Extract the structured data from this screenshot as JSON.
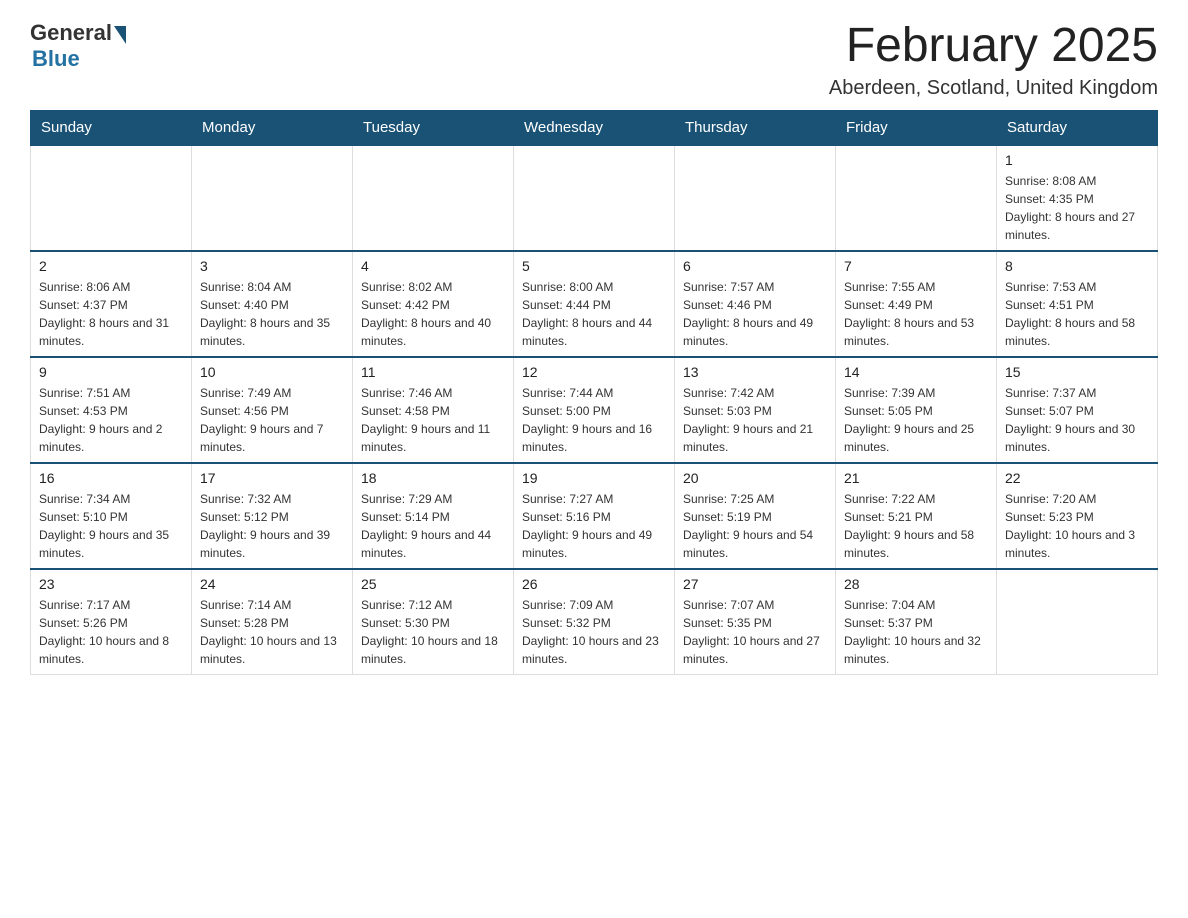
{
  "logo": {
    "general": "General",
    "blue": "Blue"
  },
  "header": {
    "title": "February 2025",
    "subtitle": "Aberdeen, Scotland, United Kingdom"
  },
  "weekdays": [
    "Sunday",
    "Monday",
    "Tuesday",
    "Wednesday",
    "Thursday",
    "Friday",
    "Saturday"
  ],
  "weeks": [
    [
      {
        "day": "",
        "info": ""
      },
      {
        "day": "",
        "info": ""
      },
      {
        "day": "",
        "info": ""
      },
      {
        "day": "",
        "info": ""
      },
      {
        "day": "",
        "info": ""
      },
      {
        "day": "",
        "info": ""
      },
      {
        "day": "1",
        "info": "Sunrise: 8:08 AM\nSunset: 4:35 PM\nDaylight: 8 hours and 27 minutes."
      }
    ],
    [
      {
        "day": "2",
        "info": "Sunrise: 8:06 AM\nSunset: 4:37 PM\nDaylight: 8 hours and 31 minutes."
      },
      {
        "day": "3",
        "info": "Sunrise: 8:04 AM\nSunset: 4:40 PM\nDaylight: 8 hours and 35 minutes."
      },
      {
        "day": "4",
        "info": "Sunrise: 8:02 AM\nSunset: 4:42 PM\nDaylight: 8 hours and 40 minutes."
      },
      {
        "day": "5",
        "info": "Sunrise: 8:00 AM\nSunset: 4:44 PM\nDaylight: 8 hours and 44 minutes."
      },
      {
        "day": "6",
        "info": "Sunrise: 7:57 AM\nSunset: 4:46 PM\nDaylight: 8 hours and 49 minutes."
      },
      {
        "day": "7",
        "info": "Sunrise: 7:55 AM\nSunset: 4:49 PM\nDaylight: 8 hours and 53 minutes."
      },
      {
        "day": "8",
        "info": "Sunrise: 7:53 AM\nSunset: 4:51 PM\nDaylight: 8 hours and 58 minutes."
      }
    ],
    [
      {
        "day": "9",
        "info": "Sunrise: 7:51 AM\nSunset: 4:53 PM\nDaylight: 9 hours and 2 minutes."
      },
      {
        "day": "10",
        "info": "Sunrise: 7:49 AM\nSunset: 4:56 PM\nDaylight: 9 hours and 7 minutes."
      },
      {
        "day": "11",
        "info": "Sunrise: 7:46 AM\nSunset: 4:58 PM\nDaylight: 9 hours and 11 minutes."
      },
      {
        "day": "12",
        "info": "Sunrise: 7:44 AM\nSunset: 5:00 PM\nDaylight: 9 hours and 16 minutes."
      },
      {
        "day": "13",
        "info": "Sunrise: 7:42 AM\nSunset: 5:03 PM\nDaylight: 9 hours and 21 minutes."
      },
      {
        "day": "14",
        "info": "Sunrise: 7:39 AM\nSunset: 5:05 PM\nDaylight: 9 hours and 25 minutes."
      },
      {
        "day": "15",
        "info": "Sunrise: 7:37 AM\nSunset: 5:07 PM\nDaylight: 9 hours and 30 minutes."
      }
    ],
    [
      {
        "day": "16",
        "info": "Sunrise: 7:34 AM\nSunset: 5:10 PM\nDaylight: 9 hours and 35 minutes."
      },
      {
        "day": "17",
        "info": "Sunrise: 7:32 AM\nSunset: 5:12 PM\nDaylight: 9 hours and 39 minutes."
      },
      {
        "day": "18",
        "info": "Sunrise: 7:29 AM\nSunset: 5:14 PM\nDaylight: 9 hours and 44 minutes."
      },
      {
        "day": "19",
        "info": "Sunrise: 7:27 AM\nSunset: 5:16 PM\nDaylight: 9 hours and 49 minutes."
      },
      {
        "day": "20",
        "info": "Sunrise: 7:25 AM\nSunset: 5:19 PM\nDaylight: 9 hours and 54 minutes."
      },
      {
        "day": "21",
        "info": "Sunrise: 7:22 AM\nSunset: 5:21 PM\nDaylight: 9 hours and 58 minutes."
      },
      {
        "day": "22",
        "info": "Sunrise: 7:20 AM\nSunset: 5:23 PM\nDaylight: 10 hours and 3 minutes."
      }
    ],
    [
      {
        "day": "23",
        "info": "Sunrise: 7:17 AM\nSunset: 5:26 PM\nDaylight: 10 hours and 8 minutes."
      },
      {
        "day": "24",
        "info": "Sunrise: 7:14 AM\nSunset: 5:28 PM\nDaylight: 10 hours and 13 minutes."
      },
      {
        "day": "25",
        "info": "Sunrise: 7:12 AM\nSunset: 5:30 PM\nDaylight: 10 hours and 18 minutes."
      },
      {
        "day": "26",
        "info": "Sunrise: 7:09 AM\nSunset: 5:32 PM\nDaylight: 10 hours and 23 minutes."
      },
      {
        "day": "27",
        "info": "Sunrise: 7:07 AM\nSunset: 5:35 PM\nDaylight: 10 hours and 27 minutes."
      },
      {
        "day": "28",
        "info": "Sunrise: 7:04 AM\nSunset: 5:37 PM\nDaylight: 10 hours and 32 minutes."
      },
      {
        "day": "",
        "info": ""
      }
    ]
  ]
}
